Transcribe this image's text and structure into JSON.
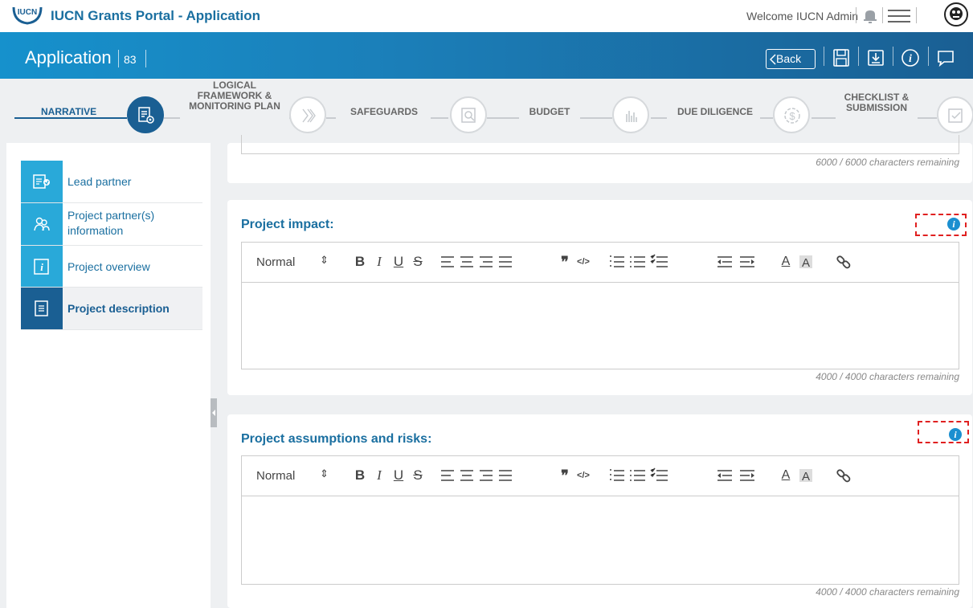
{
  "topbar": {
    "logo_text": "IUCN",
    "app_title": "IUCN Grants Portal - Application",
    "welcome_text": "Welcome IUCN Admin"
  },
  "header": {
    "title": "Application",
    "id_number": "83",
    "back_label": "Back"
  },
  "stepper": {
    "steps": [
      {
        "label": "NARRATIVE",
        "icon": "document-gear-icon"
      },
      {
        "label": "LOGICAL FRAMEWORK & MONITORING PLAN",
        "icon": "chevrons-icon"
      },
      {
        "label": "SAFEGUARDS",
        "icon": "search-document-icon"
      },
      {
        "label": "BUDGET",
        "icon": "bar-chart-icon"
      },
      {
        "label": "DUE DILIGENCE",
        "icon": "dollar-circle-icon"
      },
      {
        "label": "CHECKLIST & SUBMISSION",
        "icon": "checklist-icon"
      }
    ]
  },
  "sidebar": {
    "items": [
      {
        "label": "Lead partner",
        "icon": "lead-partner-icon"
      },
      {
        "label": "Project partner(s) information",
        "icon": "partners-icon"
      },
      {
        "label": "Project overview",
        "icon": "info-document-icon"
      },
      {
        "label": "Project description",
        "icon": "document-icon"
      }
    ]
  },
  "sections": {
    "previous": {
      "char_count": "6000 / 6000 characters remaining"
    },
    "impact": {
      "title": "Project impact:",
      "char_count": "4000 / 4000 characters remaining",
      "format": "Normal"
    },
    "risks": {
      "title": "Project assumptions and risks:",
      "char_count": "4000 / 4000 characters remaining",
      "format": "Normal"
    }
  },
  "toolbar": {
    "bold": "B",
    "italic": "I",
    "underline": "U",
    "strike": "S",
    "quote": "❞",
    "code": "</>",
    "font_color": "A"
  },
  "colors": {
    "primary": "#1a5f93",
    "accent": "#29a9d9",
    "title": "#1a6fa0",
    "info": "#1b8fd0",
    "highlight_box": "#e02020"
  }
}
